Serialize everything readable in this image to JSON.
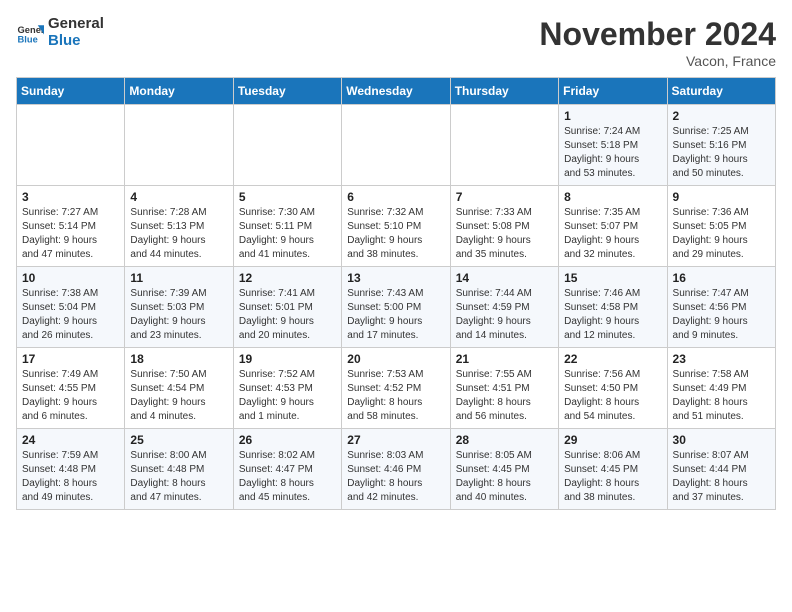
{
  "header": {
    "logo_text_general": "General",
    "logo_text_blue": "Blue",
    "month": "November 2024",
    "location": "Vacon, France"
  },
  "days_of_week": [
    "Sunday",
    "Monday",
    "Tuesday",
    "Wednesday",
    "Thursday",
    "Friday",
    "Saturday"
  ],
  "weeks": [
    [
      {
        "day": "",
        "info": ""
      },
      {
        "day": "",
        "info": ""
      },
      {
        "day": "",
        "info": ""
      },
      {
        "day": "",
        "info": ""
      },
      {
        "day": "",
        "info": ""
      },
      {
        "day": "1",
        "info": "Sunrise: 7:24 AM\nSunset: 5:18 PM\nDaylight: 9 hours\nand 53 minutes."
      },
      {
        "day": "2",
        "info": "Sunrise: 7:25 AM\nSunset: 5:16 PM\nDaylight: 9 hours\nand 50 minutes."
      }
    ],
    [
      {
        "day": "3",
        "info": "Sunrise: 7:27 AM\nSunset: 5:14 PM\nDaylight: 9 hours\nand 47 minutes."
      },
      {
        "day": "4",
        "info": "Sunrise: 7:28 AM\nSunset: 5:13 PM\nDaylight: 9 hours\nand 44 minutes."
      },
      {
        "day": "5",
        "info": "Sunrise: 7:30 AM\nSunset: 5:11 PM\nDaylight: 9 hours\nand 41 minutes."
      },
      {
        "day": "6",
        "info": "Sunrise: 7:32 AM\nSunset: 5:10 PM\nDaylight: 9 hours\nand 38 minutes."
      },
      {
        "day": "7",
        "info": "Sunrise: 7:33 AM\nSunset: 5:08 PM\nDaylight: 9 hours\nand 35 minutes."
      },
      {
        "day": "8",
        "info": "Sunrise: 7:35 AM\nSunset: 5:07 PM\nDaylight: 9 hours\nand 32 minutes."
      },
      {
        "day": "9",
        "info": "Sunrise: 7:36 AM\nSunset: 5:05 PM\nDaylight: 9 hours\nand 29 minutes."
      }
    ],
    [
      {
        "day": "10",
        "info": "Sunrise: 7:38 AM\nSunset: 5:04 PM\nDaylight: 9 hours\nand 26 minutes."
      },
      {
        "day": "11",
        "info": "Sunrise: 7:39 AM\nSunset: 5:03 PM\nDaylight: 9 hours\nand 23 minutes."
      },
      {
        "day": "12",
        "info": "Sunrise: 7:41 AM\nSunset: 5:01 PM\nDaylight: 9 hours\nand 20 minutes."
      },
      {
        "day": "13",
        "info": "Sunrise: 7:43 AM\nSunset: 5:00 PM\nDaylight: 9 hours\nand 17 minutes."
      },
      {
        "day": "14",
        "info": "Sunrise: 7:44 AM\nSunset: 4:59 PM\nDaylight: 9 hours\nand 14 minutes."
      },
      {
        "day": "15",
        "info": "Sunrise: 7:46 AM\nSunset: 4:58 PM\nDaylight: 9 hours\nand 12 minutes."
      },
      {
        "day": "16",
        "info": "Sunrise: 7:47 AM\nSunset: 4:56 PM\nDaylight: 9 hours\nand 9 minutes."
      }
    ],
    [
      {
        "day": "17",
        "info": "Sunrise: 7:49 AM\nSunset: 4:55 PM\nDaylight: 9 hours\nand 6 minutes."
      },
      {
        "day": "18",
        "info": "Sunrise: 7:50 AM\nSunset: 4:54 PM\nDaylight: 9 hours\nand 4 minutes."
      },
      {
        "day": "19",
        "info": "Sunrise: 7:52 AM\nSunset: 4:53 PM\nDaylight: 9 hours\nand 1 minute."
      },
      {
        "day": "20",
        "info": "Sunrise: 7:53 AM\nSunset: 4:52 PM\nDaylight: 8 hours\nand 58 minutes."
      },
      {
        "day": "21",
        "info": "Sunrise: 7:55 AM\nSunset: 4:51 PM\nDaylight: 8 hours\nand 56 minutes."
      },
      {
        "day": "22",
        "info": "Sunrise: 7:56 AM\nSunset: 4:50 PM\nDaylight: 8 hours\nand 54 minutes."
      },
      {
        "day": "23",
        "info": "Sunrise: 7:58 AM\nSunset: 4:49 PM\nDaylight: 8 hours\nand 51 minutes."
      }
    ],
    [
      {
        "day": "24",
        "info": "Sunrise: 7:59 AM\nSunset: 4:48 PM\nDaylight: 8 hours\nand 49 minutes."
      },
      {
        "day": "25",
        "info": "Sunrise: 8:00 AM\nSunset: 4:48 PM\nDaylight: 8 hours\nand 47 minutes."
      },
      {
        "day": "26",
        "info": "Sunrise: 8:02 AM\nSunset: 4:47 PM\nDaylight: 8 hours\nand 45 minutes."
      },
      {
        "day": "27",
        "info": "Sunrise: 8:03 AM\nSunset: 4:46 PM\nDaylight: 8 hours\nand 42 minutes."
      },
      {
        "day": "28",
        "info": "Sunrise: 8:05 AM\nSunset: 4:45 PM\nDaylight: 8 hours\nand 40 minutes."
      },
      {
        "day": "29",
        "info": "Sunrise: 8:06 AM\nSunset: 4:45 PM\nDaylight: 8 hours\nand 38 minutes."
      },
      {
        "day": "30",
        "info": "Sunrise: 8:07 AM\nSunset: 4:44 PM\nDaylight: 8 hours\nand 37 minutes."
      }
    ]
  ]
}
